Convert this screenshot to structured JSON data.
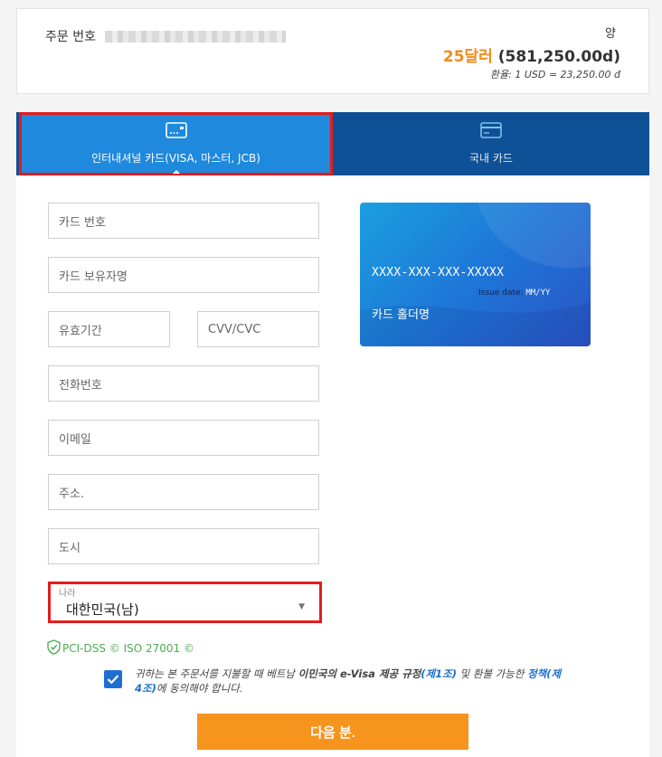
{
  "order": {
    "number_label": "주문 번호",
    "amount_label": "양",
    "amount_usd": "25달러",
    "amount_vnd": "(581,250.00d)",
    "rate": "환율: 1 USD = 23,250.00 đ"
  },
  "tabs": [
    {
      "label": "인터내셔널 카드(VISA, 마스터, JCB)",
      "icon": "credit-card-icon",
      "active": true
    },
    {
      "label": "국내 카드",
      "icon": "domestic-card-icon",
      "active": false
    }
  ],
  "form": {
    "card_number": "카드 번호",
    "card_holder": "카드 보유자명",
    "expiry": "유효기간",
    "cvv": "CVV/CVC",
    "phone": "전화번호",
    "email": "이메일",
    "address": "주소.",
    "city": "도시",
    "country_label": "나라",
    "country_value": "대한민국(남)"
  },
  "card_preview": {
    "number": "XXXX-XXX-XXX-XXXXX",
    "issue_label": "Issue date:",
    "issue_value": "MM/YY",
    "holder": "카드 홀더명"
  },
  "security": {
    "text": "PCI-DSS © ISO 27001 ©",
    "color": "#4caf50"
  },
  "agreement": {
    "t1": "귀하는 본 주문서를 지불할 때 베트남 ",
    "t2": "이민국의 e-Visa 제공 규정",
    "l1": "(제1조)",
    "t3": " 및 환불 가능한 ",
    "l2": "정책(제4조)",
    "t4": "에 동의해야 합니다."
  },
  "next_label": "다음 분.",
  "colors": {
    "accent": "#f7941d",
    "tab_active": "#1e89dd",
    "tab_bar": "#0f5196",
    "highlight": "#e51b1b",
    "link": "#1e6fd2"
  }
}
